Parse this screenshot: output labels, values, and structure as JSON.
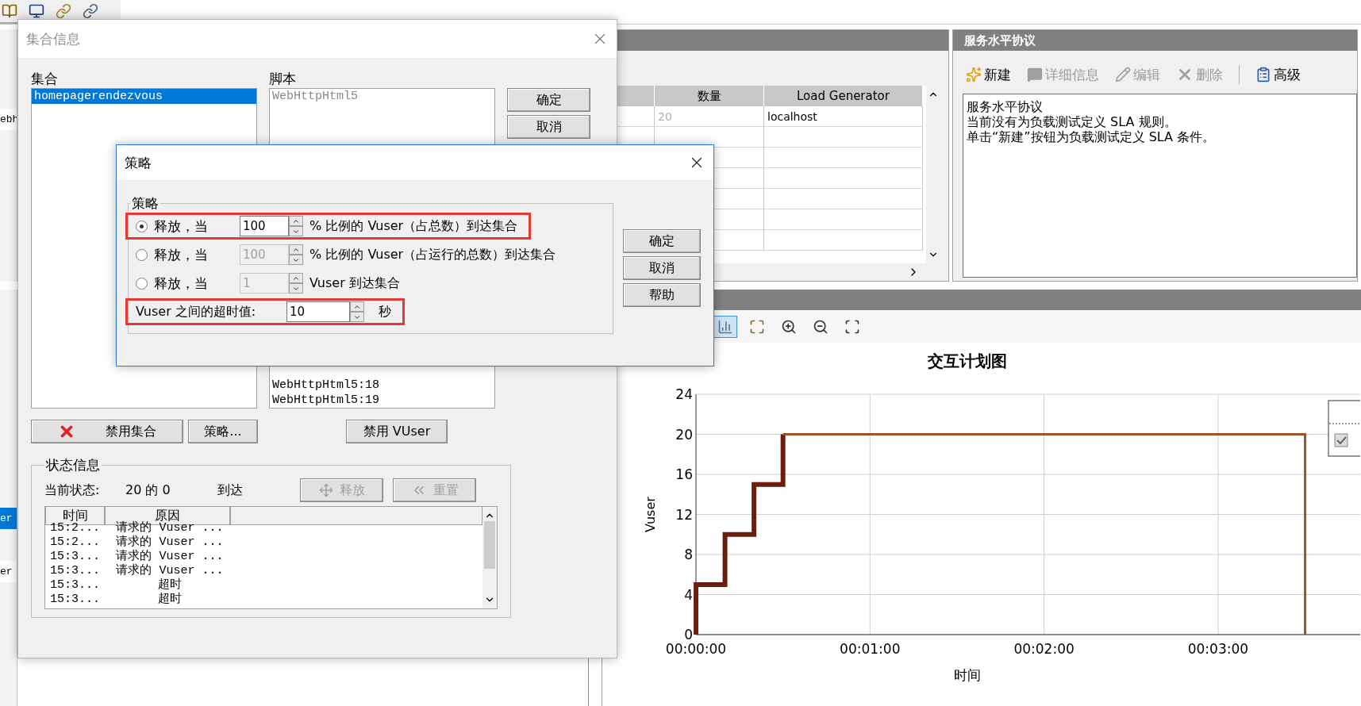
{
  "left_strip": {
    "top": [
      {
        "text": "ebh",
        "selected": false
      }
    ],
    "bottom": [
      {
        "text": "er",
        "selected": true
      },
      {
        "text": "er",
        "selected": false
      }
    ]
  },
  "load_panel": {
    "columns": [
      {
        "label": "数量"
      },
      {
        "label": "Load Generator"
      }
    ],
    "rows": [
      {
        "count": "20",
        "load_generator": "localhost"
      }
    ]
  },
  "sla_panel": {
    "title": "服务水平协议",
    "tools": [
      {
        "kind": "new",
        "label": "新建",
        "disabled": false
      },
      {
        "kind": "details",
        "label": "详细信息",
        "disabled": true
      },
      {
        "kind": "edit",
        "label": "编辑",
        "disabled": true
      },
      {
        "kind": "delete",
        "label": "删除",
        "disabled": true
      },
      {
        "kind": "advanced",
        "label": "高级",
        "disabled": false
      }
    ],
    "text": [
      "服务水平协议",
      "当前没有为负载测试定义 SLA 规则。",
      "单击“新建”按钮为负载测试定义 SLA 条件。"
    ]
  },
  "schedule_panel": {
    "tools": [
      {
        "kind": "chart",
        "selected": true
      },
      {
        "kind": "fit",
        "selected": false
      },
      {
        "kind": "zoom_in",
        "selected": false
      },
      {
        "kind": "zoom_out",
        "selected": false
      },
      {
        "kind": "zoom_reset",
        "selected": false
      }
    ],
    "chart_data": {
      "type": "line",
      "grid": true,
      "title": "交互计划图",
      "xlabel": "时间",
      "ylabel": "Vuser",
      "x": [
        0,
        0,
        10,
        10,
        20,
        20,
        30,
        30,
        210,
        210
      ],
      "series": [
        {
          "color": "#6b1d0e",
          "values": [
            0,
            5,
            5,
            10,
            10,
            15,
            15,
            20,
            null,
            null
          ]
        },
        {
          "color": "#a0522d",
          "values": [
            null,
            null,
            null,
            null,
            null,
            null,
            null,
            20,
            20,
            0
          ]
        }
      ],
      "xlim": [
        0,
        229
      ],
      "ylim": [
        0,
        24
      ],
      "xticks": [
        {
          "value": 0,
          "label": "00:00:00"
        },
        {
          "value": 60,
          "label": "00:01:00"
        },
        {
          "value": 120,
          "label": "00:02:00"
        },
        {
          "value": 180,
          "label": "00:03:00"
        }
      ],
      "yticks": [
        0,
        4,
        8,
        12,
        16,
        20,
        24
      ]
    }
  },
  "rendezvous_dialog": {
    "title": "集合信息",
    "active": false,
    "rendezvous_label": "集合",
    "rendezvous": [
      {
        "text": "homepagerendezvous",
        "selected": true
      }
    ],
    "scripts_label": "脚本",
    "scripts": [
      {
        "text": "WebHttpHtml5",
        "disabled": true
      },
      {
        "text": "WebHttpHtml5:18",
        "disabled": false
      },
      {
        "text": "WebHttpHtml5:19",
        "disabled": false
      }
    ],
    "buttons": [
      "确定",
      "取消"
    ],
    "actions": [
      {
        "kind": "disable_rendezvous",
        "label": "禁用集合"
      },
      {
        "kind": "policy",
        "label": "策略..."
      },
      {
        "kind": "disable_vuser",
        "label": "禁用 VUser"
      }
    ],
    "status": {
      "title": "状态信息",
      "state_label": "当前状态:",
      "state_value": "20 的 0",
      "state_suffix": "到达",
      "buttons": [
        {
          "kind": "release",
          "label": "释放",
          "disabled": true
        },
        {
          "kind": "reset",
          "label": "重置",
          "disabled": true
        }
      ],
      "columns": [
        "时间",
        "原因"
      ],
      "rows": [
        {
          "time": "15:2...",
          "reason": "请求的 Vuser ..."
        },
        {
          "time": "15:2...",
          "reason": "请求的 Vuser ..."
        },
        {
          "time": "15:3...",
          "reason": "请求的 Vuser ..."
        },
        {
          "time": "15:3...",
          "reason": "请求的 Vuser ..."
        },
        {
          "time": "15:3...",
          "reason": "超时"
        },
        {
          "time": "15:3...",
          "reason": "超时"
        }
      ]
    }
  },
  "policy_dialog": {
    "title": "策略",
    "active": true,
    "group_title": "策略",
    "options": [
      {
        "selected": true,
        "label": "释放，当",
        "value": "100",
        "disabled": false,
        "suffix": "% 比例的 Vuser（占总数）到达集合",
        "highlighted": true
      },
      {
        "selected": false,
        "label": "释放，当",
        "value": "100",
        "disabled": true,
        "suffix": "% 比例的 Vuser（占运行的总数）到达集合",
        "highlighted": false
      },
      {
        "selected": false,
        "label": "释放，当",
        "value": "1",
        "disabled": true,
        "suffix": "Vuser 到达集合",
        "highlighted": false
      }
    ],
    "timeout": {
      "label": "Vuser 之间的超时值:",
      "value": "10",
      "unit": "秒",
      "highlighted": true
    },
    "buttons": [
      "确定",
      "取消",
      "帮助"
    ]
  }
}
